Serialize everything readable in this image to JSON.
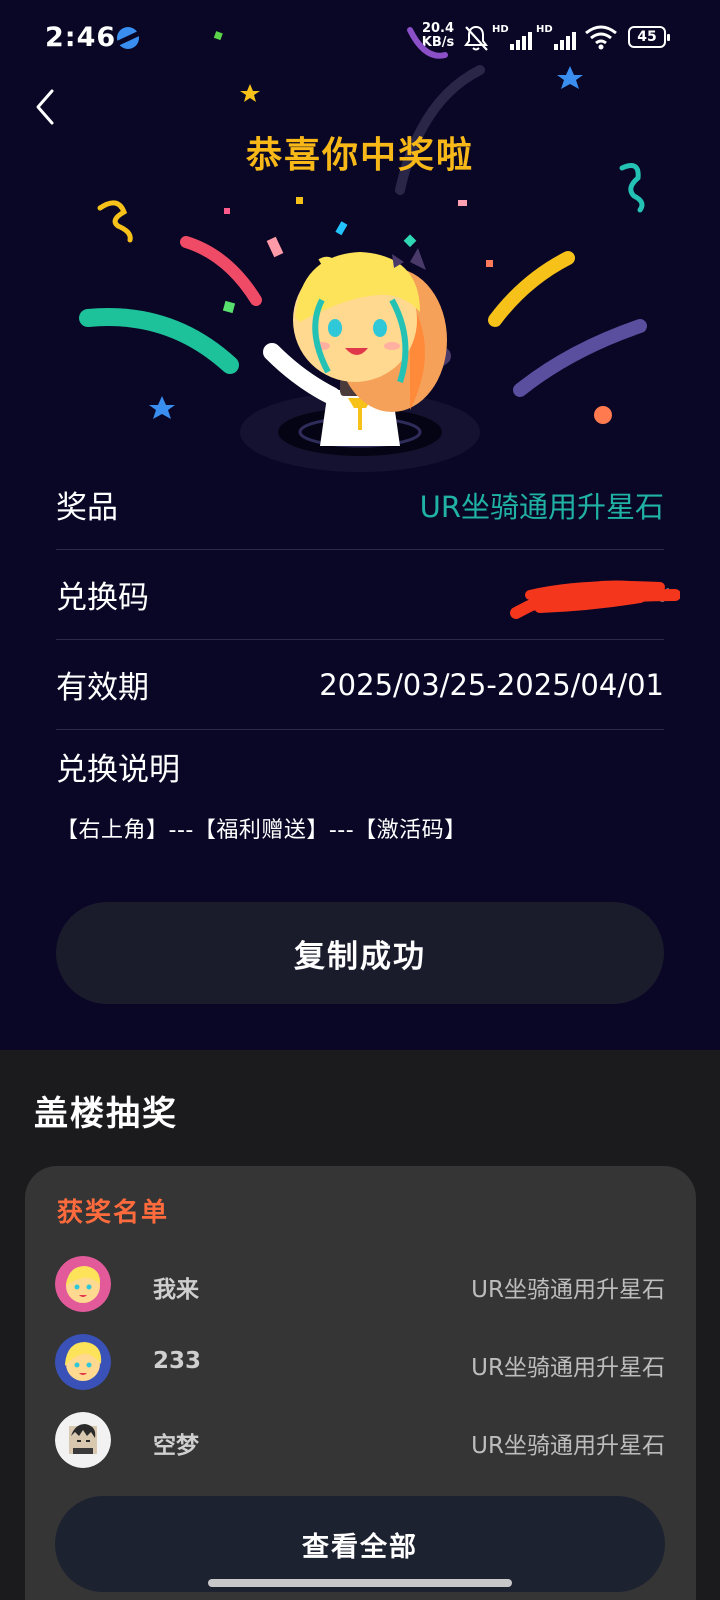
{
  "status_bar": {
    "time": "2:46",
    "speed_value": "20.4",
    "speed_unit": "KB/s",
    "hd_1": "HD",
    "hd_2": "HD",
    "battery": "45"
  },
  "header": {
    "title": "恭喜你中奖啦"
  },
  "details": {
    "prize_label": "奖品",
    "prize_value": "UR坐骑通用升星石",
    "code_label": "兑换码",
    "code_value": "····· ·· ·v",
    "validity_label": "有效期",
    "validity_value": "2025/03/25-2025/04/01",
    "instructions_label": "兑换说明",
    "instructions_text": "【右上角】---【福利赠送】---【激活码】"
  },
  "copy_button": {
    "label": "复制成功"
  },
  "lottery": {
    "section_title": "盖楼抽奖",
    "winners_title": "获奖名单",
    "winners": [
      {
        "name": "我来",
        "prize": "UR坐骑通用升星石"
      },
      {
        "name": "233",
        "prize": "UR坐骑通用升星石"
      },
      {
        "name": "空梦",
        "prize": "UR坐骑通用升星石"
      }
    ],
    "view_all_label": "查看全部"
  },
  "colors": {
    "page_bg": "#090626",
    "title": "#f8b818",
    "prize_teal": "#20b2a4",
    "winners_orange": "#ff6b3d",
    "card_bg": "#353535",
    "redaction": "#f4361c"
  }
}
